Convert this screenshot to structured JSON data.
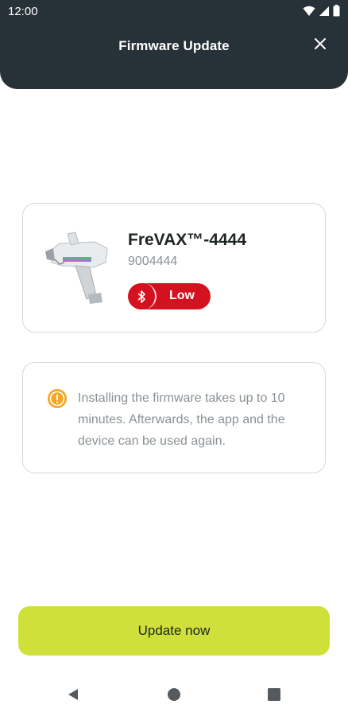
{
  "status_bar": {
    "time": "12:00",
    "icons": [
      "wifi-icon",
      "signal-icon",
      "battery-icon"
    ]
  },
  "header": {
    "title": "Firmware Update",
    "close_icon": "close-icon"
  },
  "device": {
    "name": "FreVAX™-4444",
    "serial": "9004444",
    "battery_label": "Low",
    "bluetooth_icon": "bluetooth-icon",
    "colors": {
      "badge": "#d4111e"
    }
  },
  "info": {
    "icon": "info-icon",
    "text": "Installing the firmware takes up to 10 minutes. Afterwards, the app and the device can be used again.",
    "colors": {
      "icon": "#f5a623"
    }
  },
  "actions": {
    "update_label": "Update now",
    "colors": {
      "button": "#cfe03a"
    }
  },
  "nav": {
    "icons": [
      "back-icon",
      "home-icon",
      "recents-icon"
    ]
  },
  "theme": {
    "header_bg": "#263238"
  }
}
